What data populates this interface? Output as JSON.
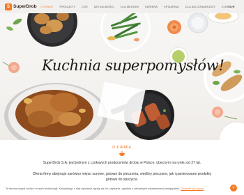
{
  "brand": {
    "name": "SuperDrob",
    "mark": "S"
  },
  "nav": {
    "items": [
      {
        "label": "O FIRMIE",
        "active": true
      },
      {
        "label": "PRODUKTY"
      },
      {
        "label": "CSR"
      },
      {
        "label": "AKTUALNOŚCI"
      },
      {
        "label": "DLA MEDIÓW"
      },
      {
        "label": "KARIERA"
      },
      {
        "label": "SPIŻARNIA"
      },
      {
        "label": "DLA AKCJONARIUSZY"
      },
      {
        "label": "KONTAKT"
      }
    ],
    "language": "PL"
  },
  "hero": {
    "headline": "Kuchnia superpomysłów!"
  },
  "about": {
    "title": "O FIRMIE",
    "paragraph1": "SuperDrob S.A. jest jednym z czołowych producentów drobiu w Polsce, obecnym na rynku od 27 lat.",
    "paragraph2": "Oferta firmy obejmuje zarówno mięso surowe, gotowe do pieczenia, wędliny pieczone, jak i panierowane produkty gotowe do spożycia."
  },
  "cookie": {
    "text": "Ta strona używa cookie i innych technologii. Korzystając z niej wyrażasz zgodę na ich używanie, zgodnie z aktualnymi ustawieniami przeglądarki.",
    "link": "Dowiedz się więcej",
    "close": "×"
  },
  "colors": {
    "accent": "#f47a20",
    "nav_bg": "#f2f0ee",
    "text": "#333333"
  }
}
